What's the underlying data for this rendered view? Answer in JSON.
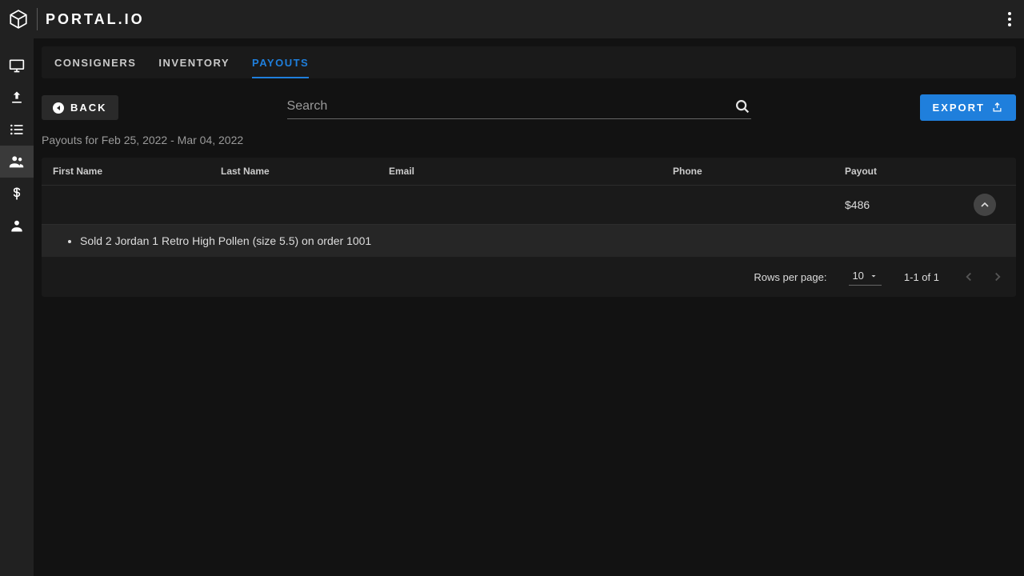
{
  "brand": {
    "name": "PORTAL.IO"
  },
  "tabs": [
    {
      "label": "CONSIGNERS"
    },
    {
      "label": "INVENTORY"
    },
    {
      "label": "PAYOUTS",
      "active": true
    }
  ],
  "toolbar": {
    "back_label": "BACK",
    "export_label": "EXPORT",
    "search_placeholder": "Search"
  },
  "subtitle": "Payouts for Feb 25, 2022 - Mar 04, 2022",
  "columns": {
    "first": "First Name",
    "last": "Last Name",
    "email": "Email",
    "phone": "Phone",
    "payout": "Payout"
  },
  "rows": [
    {
      "first": "",
      "last": "",
      "email": "",
      "phone": "",
      "payout": "$486",
      "details": [
        "Sold 2 Jordan 1 Retro High Pollen (size 5.5) on order 1001"
      ]
    }
  ],
  "pagination": {
    "rpp_label": "Rows per page:",
    "rpp_value": "10",
    "range": "1-1 of 1"
  }
}
